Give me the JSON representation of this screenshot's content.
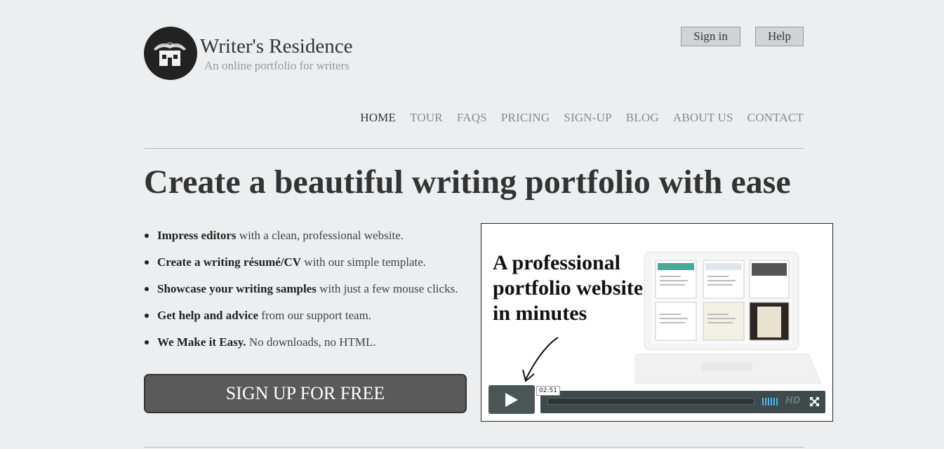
{
  "brand": {
    "title": "Writer's Residence",
    "tagline": "An online portfolio for writers"
  },
  "top_buttons": {
    "signin": "Sign in",
    "help": "Help"
  },
  "nav": {
    "home": "HOME",
    "tour": "TOUR",
    "faqs": "FAQS",
    "pricing": "PRICING",
    "signup": "SIGN-UP",
    "blog": "BLOG",
    "about": "ABOUT US",
    "contact": "CONTACT"
  },
  "headline": "Create a beautiful writing portfolio with ease",
  "bullets": [
    {
      "strong": "Impress editors",
      "rest": " with a clean, professional website."
    },
    {
      "strong": "Create a writing résumé/CV",
      "rest": " with our simple template."
    },
    {
      "strong": "Showcase your writing samples",
      "rest": " with just a few mouse clicks."
    },
    {
      "strong": "Get help and advice",
      "rest": " from our support team."
    },
    {
      "strong": "We Make it Easy.",
      "rest": " No downloads, no HTML."
    }
  ],
  "cta_label": "SIGN UP FOR FREE",
  "video": {
    "caption_line1": "A professional",
    "caption_line2": "portfolio website",
    "caption_line3": "in minutes",
    "duration": "02:51",
    "hd_label": "HD",
    "progress": 0
  },
  "colors": {
    "background": "#eceeef",
    "cta": "#5a5a5a",
    "player_bar": "#3e4a4b",
    "volume_accent": "#4db6e6"
  }
}
